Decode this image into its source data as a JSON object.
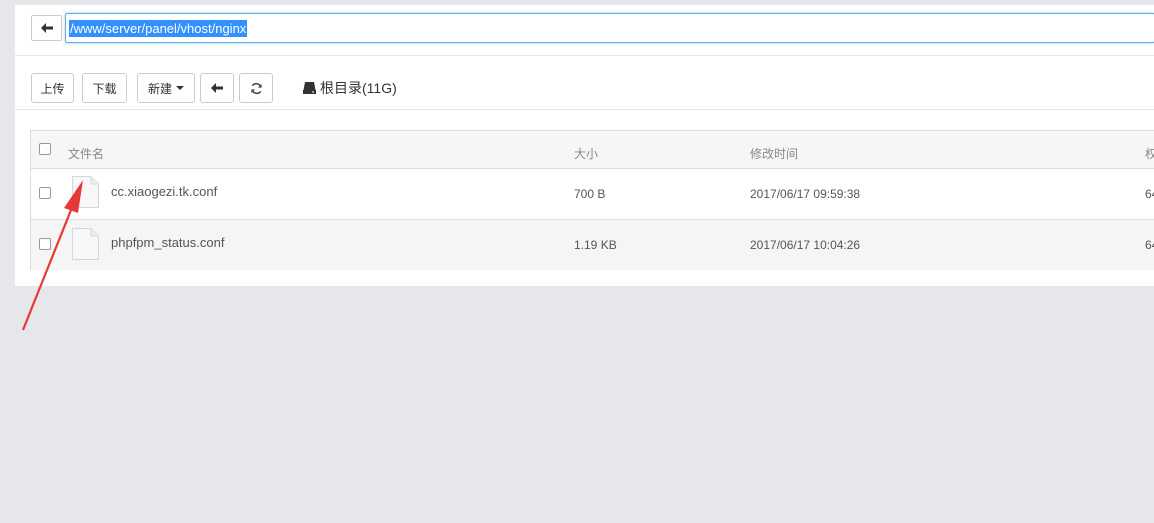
{
  "path_bar": {
    "path": "/www/server/panel/vhost/nginx"
  },
  "toolbar": {
    "upload_label": "上传",
    "download_label": "下载",
    "new_label": "新建",
    "root_dir_label": "根目录(11G)"
  },
  "table": {
    "columns": [
      "文件名",
      "大小",
      "修改时间",
      "权"
    ],
    "rows": [
      {
        "name": "cc.xiaogezi.tk.conf",
        "size": "700 B",
        "mtime": "2017/06/17 09:59:38",
        "perm": "64"
      },
      {
        "name": "phpfpm_status.conf",
        "size": "1.19 KB",
        "mtime": "2017/06/17 10:04:26",
        "perm": "64"
      }
    ]
  },
  "colors": {
    "selection": "#3390ff",
    "focus_border": "#66afe9",
    "arrow": "#e53935"
  },
  "icons": [
    "arrow-left-icon",
    "refresh-icon",
    "hdd-icon",
    "file-icon",
    "caret-down-icon"
  ]
}
